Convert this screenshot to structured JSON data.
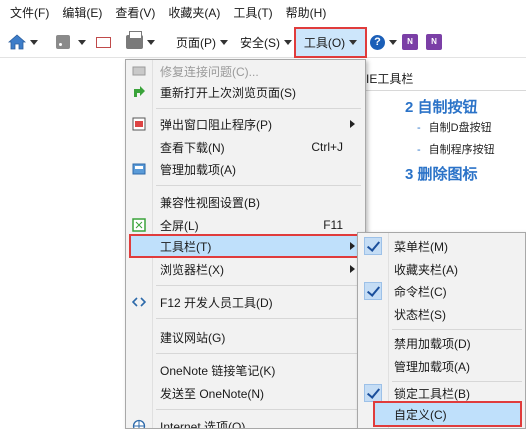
{
  "menubar": {
    "items": [
      "文件(F)",
      "编辑(E)",
      "查看(V)",
      "收藏夹(A)",
      "工具(T)",
      "帮助(H)"
    ]
  },
  "toolbar": {
    "page_label": "页面(P)",
    "safety_label": "安全(S)",
    "tools_label": "工具(O)",
    "icons": [
      "home-icon",
      "rss-icon",
      "mail-icon",
      "print-icon",
      "help-icon",
      "onenote-icon"
    ]
  },
  "page": {
    "header": "IE工具栏",
    "heading2": "2  自制按钮",
    "sub_items": [
      "自制D盘按钮",
      "自制程序按钮"
    ],
    "heading3": "3  删除图标"
  },
  "tools_menu": {
    "items": [
      {
        "label": "修复连接问题(C)...",
        "disabled": true
      },
      {
        "label": "重新打开上次浏览页面(S)"
      },
      {
        "label": "弹出窗口阻止程序(P)",
        "submenu": true
      },
      {
        "label": "查看下载(N)",
        "shortcut": "Ctrl+J"
      },
      {
        "label": "管理加载项(A)"
      },
      {
        "label": "兼容性视图设置(B)"
      },
      {
        "label": "全屏(L)",
        "shortcut": "F11"
      },
      {
        "label": "工具栏(T)",
        "submenu": true,
        "highlighted": true
      },
      {
        "label": "浏览器栏(X)",
        "submenu": true
      },
      {
        "label": "F12 开发人员工具(D)"
      },
      {
        "label": "建议网站(G)"
      },
      {
        "label": "OneNote 链接笔记(K)"
      },
      {
        "label": "发送至 OneNote(N)"
      },
      {
        "label": "Internet 选项(O)"
      }
    ]
  },
  "toolbars_submenu": {
    "items": [
      {
        "label": "菜单栏(M)",
        "checked": true
      },
      {
        "label": "收藏夹栏(A)",
        "checked": false
      },
      {
        "label": "命令栏(C)",
        "checked": true
      },
      {
        "label": "状态栏(S)",
        "checked": false
      },
      {
        "label": "禁用加载项(D)",
        "checked": false
      },
      {
        "label": "管理加载项(A)",
        "checked": false
      },
      {
        "label": "锁定工具栏(B)",
        "checked": true
      },
      {
        "label": "自定义(C)",
        "checked": false,
        "highlighted": true
      }
    ]
  },
  "colors": {
    "highlight_border": "#e03c3c",
    "highlight_fill": "#bfe0fb",
    "heading_blue": "#2b73c8"
  }
}
